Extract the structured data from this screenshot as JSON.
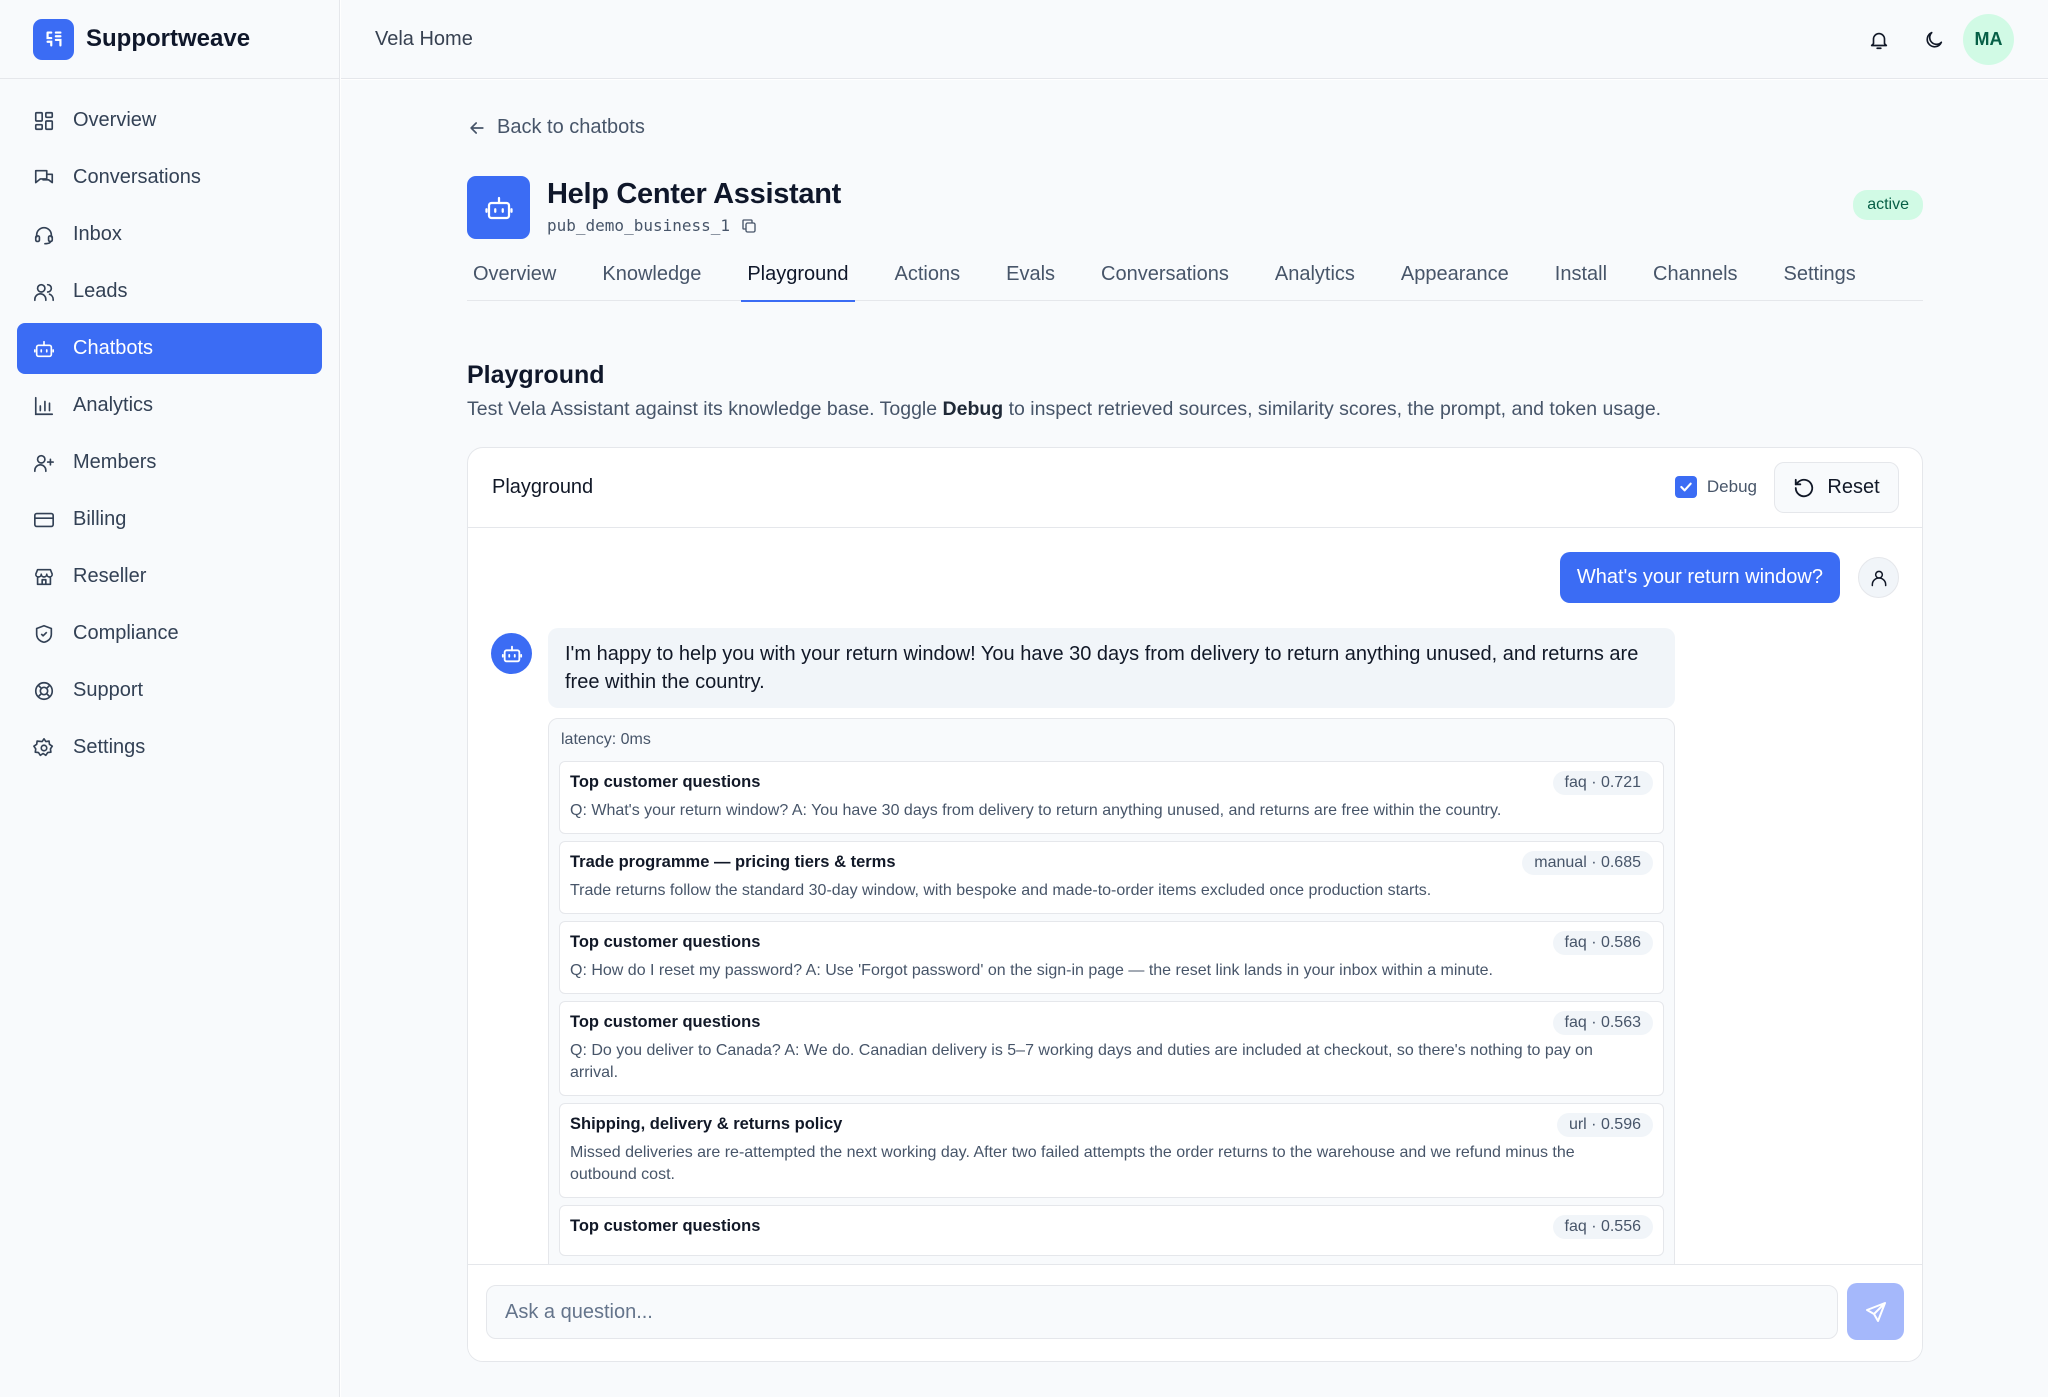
{
  "brand": {
    "name": "Supportweave"
  },
  "sidebar": {
    "items": [
      {
        "label": "Overview",
        "icon": "layout-grid-icon"
      },
      {
        "label": "Conversations",
        "icon": "messages-icon"
      },
      {
        "label": "Inbox",
        "icon": "headset-icon"
      },
      {
        "label": "Leads",
        "icon": "users-icon"
      },
      {
        "label": "Chatbots",
        "icon": "bot-icon",
        "active": true
      },
      {
        "label": "Analytics",
        "icon": "bar-chart-icon"
      },
      {
        "label": "Members",
        "icon": "user-plus-icon"
      },
      {
        "label": "Billing",
        "icon": "credit-card-icon"
      },
      {
        "label": "Reseller",
        "icon": "store-icon"
      },
      {
        "label": "Compliance",
        "icon": "shield-icon"
      },
      {
        "label": "Support",
        "icon": "life-buoy-icon"
      },
      {
        "label": "Settings",
        "icon": "gear-icon"
      }
    ]
  },
  "topbar": {
    "title": "Vela Home",
    "avatar_initials": "MA"
  },
  "back_link": "Back to chatbots",
  "bot": {
    "title": "Help Center Assistant",
    "id": "pub_demo_business_1",
    "status": "active"
  },
  "tabs": [
    "Overview",
    "Knowledge",
    "Playground",
    "Actions",
    "Evals",
    "Conversations",
    "Analytics",
    "Appearance",
    "Install",
    "Channels",
    "Settings"
  ],
  "active_tab": "Playground",
  "section": {
    "title": "Playground",
    "desc_before": "Test Vela Assistant against its knowledge base. Toggle ",
    "desc_bold": "Debug",
    "desc_after": " to inspect retrieved sources, similarity scores, the prompt, and token usage."
  },
  "playground": {
    "title": "Playground",
    "debug_label": "Debug",
    "debug_checked": true,
    "reset_label": "Reset",
    "user_message": "What's your return window?",
    "bot_message": "I'm happy to help you with your return window! You have 30 days from delivery to return anything unused, and returns are free within the country.",
    "latency": "latency: 0ms",
    "sources": [
      {
        "title": "Top customer questions",
        "badge": "faq · 0.721",
        "text": "Q: What's your return window? A: You have 30 days from delivery to return anything unused, and returns are free within the country."
      },
      {
        "title": "Trade programme — pricing tiers & terms",
        "badge": "manual · 0.685",
        "text": "Trade returns follow the standard 30-day window, with bespoke and made-to-order items excluded once production starts."
      },
      {
        "title": "Top customer questions",
        "badge": "faq · 0.586",
        "text": "Q: How do I reset my password? A: Use 'Forgot password' on the sign-in page — the reset link lands in your inbox within a minute."
      },
      {
        "title": "Top customer questions",
        "badge": "faq · 0.563",
        "text": "Q: Do you deliver to Canada? A: We do. Canadian delivery is 5–7 working days and duties are included at checkout, so there's nothing to pay on arrival."
      },
      {
        "title": "Shipping, delivery & returns policy",
        "badge": "url · 0.596",
        "text": "Missed deliveries are re-attempted the next working day. After two failed attempts the order returns to the warehouse and we refund minus the outbound cost."
      },
      {
        "title": "Top customer questions",
        "badge": "faq · 0.556",
        "text": ""
      }
    ],
    "input_placeholder": "Ask a question..."
  },
  "colors": {
    "accent": "#3b6cf4",
    "active_badge_bg": "#d1fae5",
    "active_badge_text": "#065f46"
  }
}
